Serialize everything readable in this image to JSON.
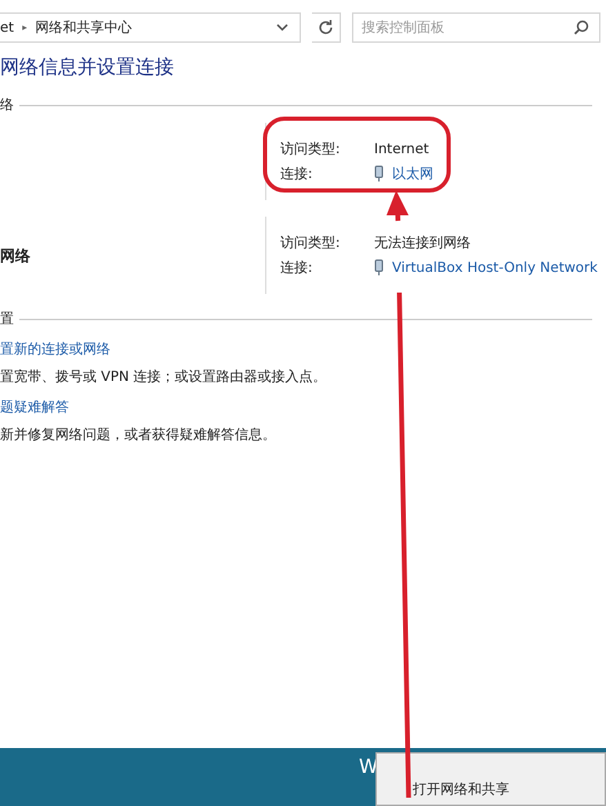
{
  "address_bar": {
    "path_start": "et",
    "separator": "▸",
    "location": "网络和共享中心",
    "search": {
      "placeholder": "搜索控制面板"
    }
  },
  "heading": "网络信息并设置连接",
  "sections": [
    {
      "title": "络",
      "networks": [
        {
          "rows": [
            {
              "label": "访问类型:",
              "value": "Internet",
              "kind": "text"
            },
            {
              "label": "连接:",
              "value": "以太网",
              "kind": "link"
            }
          ]
        },
        {
          "name": "网络",
          "rows": [
            {
              "label": "访问类型:",
              "value": "无法连接到网络",
              "kind": "text"
            },
            {
              "label": "连接:",
              "value": "VirtualBox Host-Only Network",
              "kind": "link"
            }
          ]
        }
      ]
    },
    {
      "title": "置",
      "tasks": [
        {
          "link": "置新的连接或网络",
          "description": "置宽带、拨号或 VPN 连接；或设置路由器或接入点。"
        },
        {
          "link": "题疑难解答",
          "description": "新并修复网络问题，或者获得疑难解答信息。"
        }
      ]
    }
  ],
  "taskbar": {
    "text": "W",
    "menu_item": "打开网络和共享"
  }
}
